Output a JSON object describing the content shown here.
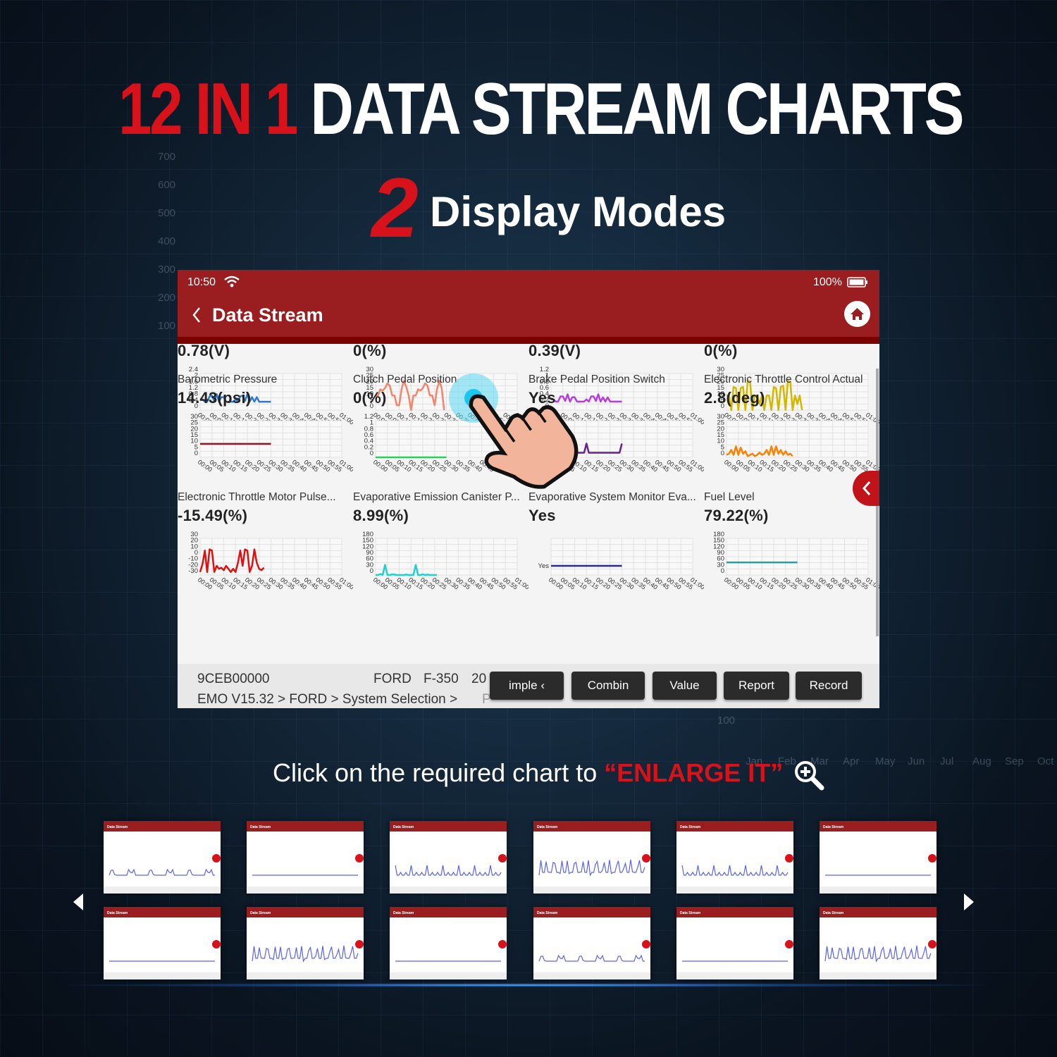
{
  "headline": {
    "part1": "12 IN 1",
    "part2": "DATA STREAM CHARTS",
    "number": "2",
    "subtitle": "Display Modes"
  },
  "background_labels": {
    "y": [
      "700",
      "600",
      "500",
      "400",
      "300",
      "200",
      "100"
    ],
    "months": [
      "Jan",
      "Feb",
      "Mar",
      "Apr",
      "May",
      "Jun",
      "Jul",
      "Aug",
      "Sep",
      "Oct"
    ],
    "extra": "100"
  },
  "colors": {
    "accent": "#d8121a",
    "header": "#9a1e20",
    "header_dark": "#7a0000"
  },
  "device": {
    "status": {
      "time": "10:50",
      "battery": "100%",
      "wifi_icon": "wifi-icon",
      "battery_icon": "battery-icon"
    },
    "nav": {
      "title": "Data Stream",
      "back_icon": "chevron-left-icon",
      "home_icon": "home-icon"
    },
    "side_tab_icon": "chevron-left-icon",
    "x_ticks": [
      "00:00",
      "00:05",
      "00:10",
      "00:15",
      "00:20",
      "00:25",
      "00:30",
      "00:35",
      "00:40",
      "00:45",
      "00:50",
      "00:55",
      "01:00"
    ],
    "charts": [
      {
        "label": "",
        "value": "0.78(V)",
        "color": "#2a78d8",
        "yticks": [
          "2.4",
          "2",
          "1.6",
          "1.2",
          "0.8",
          "0.4",
          "0"
        ],
        "ylim": [
          0,
          2.4
        ],
        "values": [
          0.7,
          0.7,
          0.55,
          0.55,
          0.9,
          0.95,
          0.6,
          1.05,
          0.55,
          0.85,
          0.85,
          0.55,
          0.55,
          0.55,
          0.55,
          0.7,
          0.55,
          0.9,
          0.95,
          0.6,
          1.05,
          0.55,
          0.85,
          0.55,
          0.85,
          0.55,
          0.55,
          0.55,
          0.55,
          0.55,
          0.55
        ]
      },
      {
        "label": "",
        "value": "0(%)",
        "color": "#f4846a",
        "yticks": [
          "30",
          "25",
          "20",
          "15",
          "10",
          "5",
          "0"
        ],
        "ylim": [
          0,
          30
        ],
        "values": [
          12,
          12,
          17,
          16,
          18,
          22,
          20,
          12,
          12,
          4,
          4,
          17,
          24,
          19,
          12,
          0,
          12,
          12,
          17,
          16,
          18,
          22,
          20,
          12,
          12,
          4,
          17,
          24,
          18,
          0
        ]
      },
      {
        "label": "",
        "value": "0.39(V)",
        "color": "#b63ee0",
        "yticks": [
          "1.2",
          "1",
          "0.8",
          "0.6",
          "0.4",
          "0.2",
          "0"
        ],
        "ylim": [
          0,
          1.2
        ],
        "values": [
          0.35,
          0.35,
          0.28,
          0.28,
          0.45,
          0.45,
          0.3,
          0.52,
          0.28,
          0.42,
          0.42,
          0.28,
          0.28,
          0.28,
          0.28,
          0.35,
          0.28,
          0.45,
          0.45,
          0.3,
          0.52,
          0.28,
          0.42,
          0.28,
          0.42,
          0.28,
          0.28,
          0.28,
          0.28,
          0.28,
          0.28
        ]
      },
      {
        "label": "",
        "value": "0(%)",
        "color": "#d4b800",
        "yticks": [
          "30",
          "25",
          "20",
          "15",
          "10",
          "5",
          "0"
        ],
        "ylim": [
          0,
          30
        ],
        "values": [
          12,
          12,
          0,
          19,
          18,
          0,
          18,
          19,
          0,
          24,
          23,
          0,
          12,
          12,
          5,
          12,
          0,
          12,
          12,
          0,
          19,
          18,
          0,
          19,
          20,
          0,
          24,
          23,
          0,
          12,
          5,
          12,
          0
        ]
      },
      {
        "label": "Barometric Pressure",
        "value": "14.43(psi)",
        "color": "#8b1a2a",
        "yticks": [
          "30",
          "25",
          "20",
          "15",
          "10",
          "5",
          "0"
        ],
        "ylim": [
          0,
          30
        ],
        "values": [
          11,
          11,
          11,
          11,
          11,
          11,
          11,
          11,
          11,
          11,
          11,
          11,
          11,
          11,
          11,
          11,
          11,
          11,
          11,
          11,
          11,
          11,
          11,
          11,
          11,
          11,
          11,
          11,
          11,
          11,
          11
        ]
      },
      {
        "label": "Clutch Pedal Position",
        "value": "0(%)",
        "color": "#2ecc60",
        "yticks": [
          "1.2",
          "1",
          "0.8",
          "0.6",
          "0.4",
          "0.2",
          "0"
        ],
        "ylim": [
          0,
          1.2
        ],
        "values": [
          0,
          0,
          0,
          0,
          0,
          0,
          0,
          0,
          0,
          0,
          0,
          0,
          0,
          0,
          0,
          0,
          0,
          0,
          0,
          0,
          0,
          0,
          0,
          0,
          0,
          0,
          0,
          0,
          0,
          0,
          0
        ]
      },
      {
        "label": "Brake Pedal Position Switch",
        "value": "Yes",
        "color": "#6a2090",
        "yticks": [
          "Yes",
          "No"
        ],
        "ylim": [
          -0.5,
          3.5
        ],
        "categorical": true,
        "values": [
          0,
          0,
          0,
          0,
          0,
          0,
          0,
          0,
          0,
          0,
          0,
          0,
          0,
          0,
          0,
          1,
          0,
          0,
          0,
          0,
          0,
          0,
          0,
          0,
          0,
          0,
          0,
          0,
          0,
          0,
          1
        ]
      },
      {
        "label": "Electronic Throttle Control Actual",
        "value": "2.8(deg)",
        "color": "#ff8000",
        "yticks": [
          "30",
          "25",
          "20",
          "15",
          "10",
          "5",
          "0"
        ],
        "ylim": [
          0,
          30
        ],
        "values": [
          2,
          3,
          6,
          2,
          9,
          2,
          8,
          3,
          5,
          1,
          2,
          3,
          1,
          2,
          4,
          2,
          3,
          6,
          2,
          9,
          2,
          9,
          3,
          6,
          2,
          5,
          2,
          3,
          1
        ]
      },
      {
        "label": "Electronic Throttle Motor Pulse...",
        "value": "-15.49(%)",
        "color": "#e01010",
        "yticks": [
          "30",
          "20",
          "10",
          "0",
          "-10",
          "-20",
          "-30"
        ],
        "ylim": [
          -30,
          30
        ],
        "values": [
          -25,
          -12,
          10,
          -25,
          12,
          10,
          -25,
          -15,
          -20,
          -18,
          -22,
          -15,
          -20,
          -25,
          -20,
          -25,
          -10,
          10,
          -15,
          12,
          10,
          -25,
          -15,
          12,
          -10,
          -20,
          -22,
          -18
        ]
      },
      {
        "label": "Evaporative Emission Canister P...",
        "value": "8.99(%)",
        "color": "#20d0d0",
        "yticks": [
          "180",
          "150",
          "120",
          "90",
          "60",
          "30",
          "0"
        ],
        "ylim": [
          0,
          180
        ],
        "values": [
          0,
          0,
          5,
          0,
          50,
          0,
          0,
          3,
          2,
          0,
          0,
          0,
          0,
          2,
          0,
          0,
          0,
          50,
          0,
          0,
          3,
          0,
          2,
          0,
          0,
          0,
          0
        ]
      },
      {
        "label": "Evaporative System Monitor Eva...",
        "value": "Yes",
        "color": "#2a2a90",
        "yticks": [
          "Yes"
        ],
        "ylim": [
          0,
          4
        ],
        "categorical": true,
        "values": [
          1,
          1,
          1,
          1,
          1,
          1,
          1,
          1,
          1,
          1,
          1,
          1,
          1,
          1,
          1,
          1,
          1,
          1,
          1,
          1,
          1,
          1,
          1,
          1,
          1,
          1,
          1,
          1,
          1,
          1,
          1
        ]
      },
      {
        "label": "Fuel Level",
        "value": "79.22(%)",
        "color": "#20a0a0",
        "yticks": [
          "180",
          "150",
          "120",
          "90",
          "60",
          "30",
          "0"
        ],
        "ylim": [
          0,
          180
        ],
        "values": [
          62,
          62,
          62,
          62,
          62,
          62,
          62,
          62,
          62,
          62,
          62,
          62,
          62,
          62,
          62,
          62,
          62,
          62,
          62,
          62,
          62,
          62,
          62,
          62,
          62,
          62,
          62,
          62,
          62,
          62,
          62
        ]
      }
    ],
    "footer": {
      "vin": "9CEB00000",
      "make": "FORD",
      "model": "F-350",
      "year": "20",
      "path": "EMO V15.32 > FORD > System Selection >",
      "path_tail": "P",
      "buttons": [
        "imple  ‹",
        "Combin",
        "Value",
        "Report",
        "Record"
      ]
    }
  },
  "caption": {
    "text": "Click on the required chart to ",
    "highlight": "“ENLARGE IT”",
    "icon": "zoom-in-icon"
  },
  "carousel": {
    "thumb_title": "Data Stream",
    "prev_icon": "arrow-left-icon",
    "next_icon": "arrow-right-icon",
    "thumbs": [
      "wave",
      "flat",
      "spiky",
      "tall",
      "spiky",
      "flat",
      "flat",
      "tall",
      "flat",
      "wave",
      "flat",
      "tall"
    ]
  }
}
